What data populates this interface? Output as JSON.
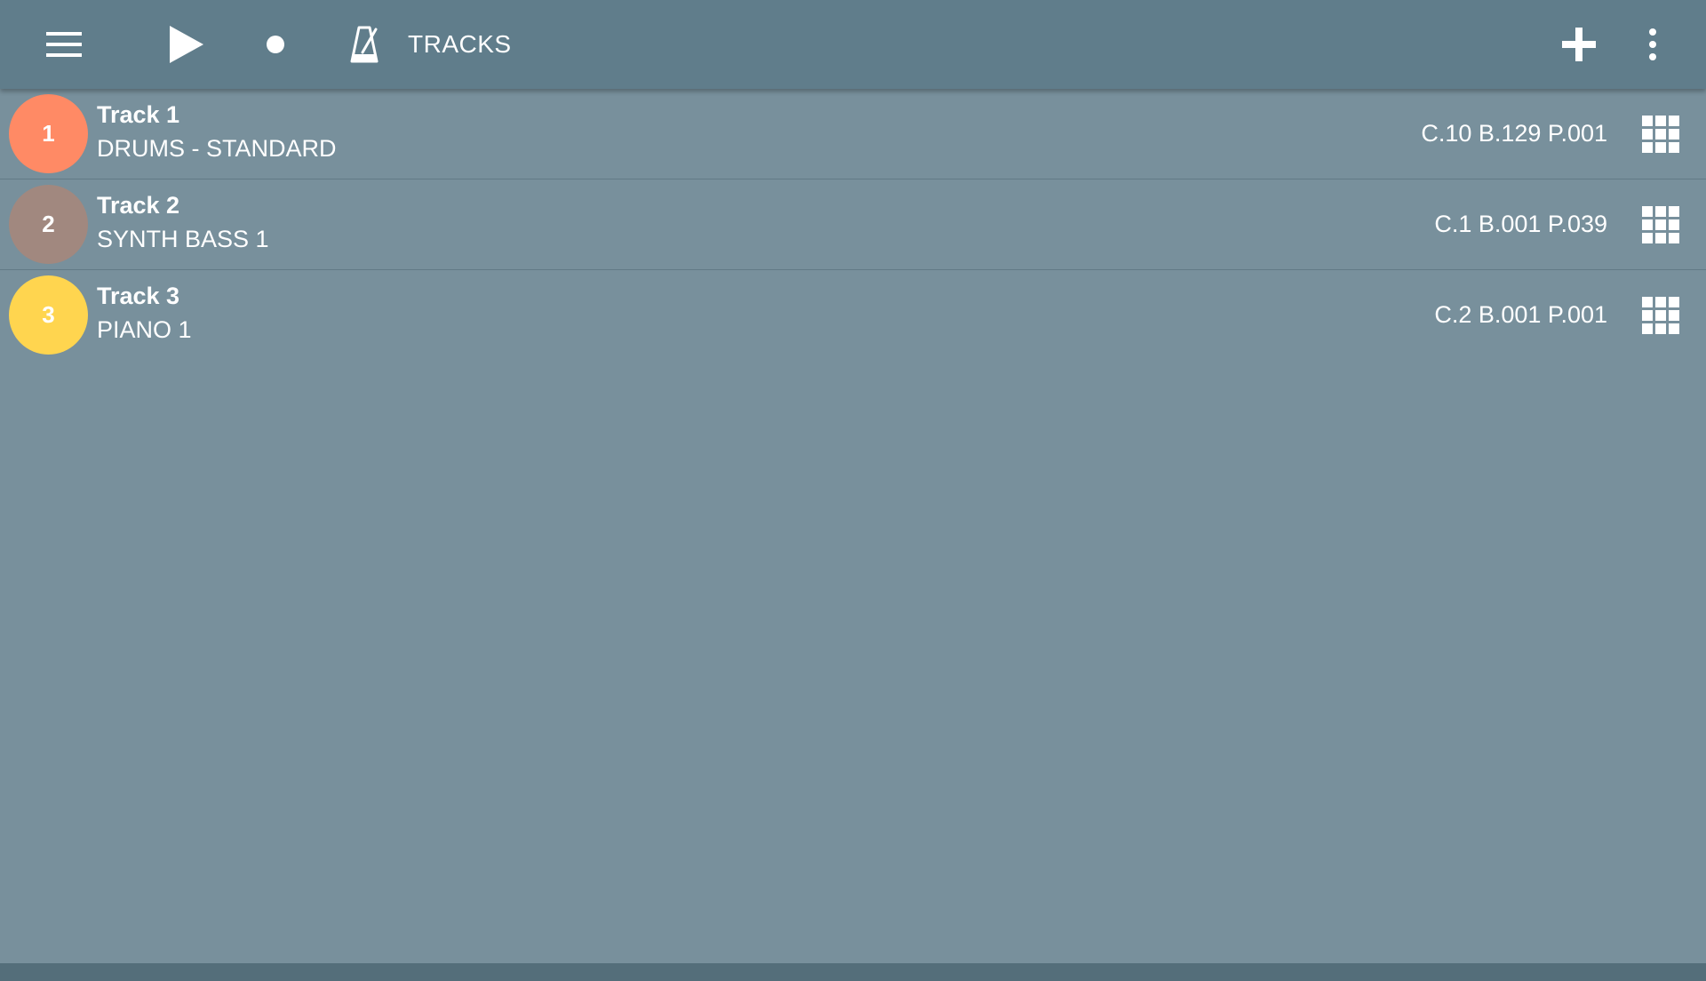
{
  "toolbar": {
    "title": "TRACKS",
    "icons": [
      "menu-icon",
      "play-icon",
      "record-icon",
      "metronome-icon",
      "add-icon",
      "more-vert-icon"
    ]
  },
  "tracks": [
    {
      "number": "1",
      "name": "Track 1",
      "instrument": "DRUMS - STANDARD",
      "params": "C.10 B.129 P.001",
      "color": "#ff8a65"
    },
    {
      "number": "2",
      "name": "Track 2",
      "instrument": "SYNTH BASS 1",
      "params": "C.1 B.001 P.039",
      "color": "#a1887f"
    },
    {
      "number": "3",
      "name": "Track 3",
      "instrument": "PIANO 1",
      "params": "C.2 B.001 P.001",
      "color": "#ffd54f"
    }
  ],
  "colors": {
    "background": "#78909c",
    "toolbar": "#607d8b",
    "bottom_bar": "#546e7a"
  }
}
